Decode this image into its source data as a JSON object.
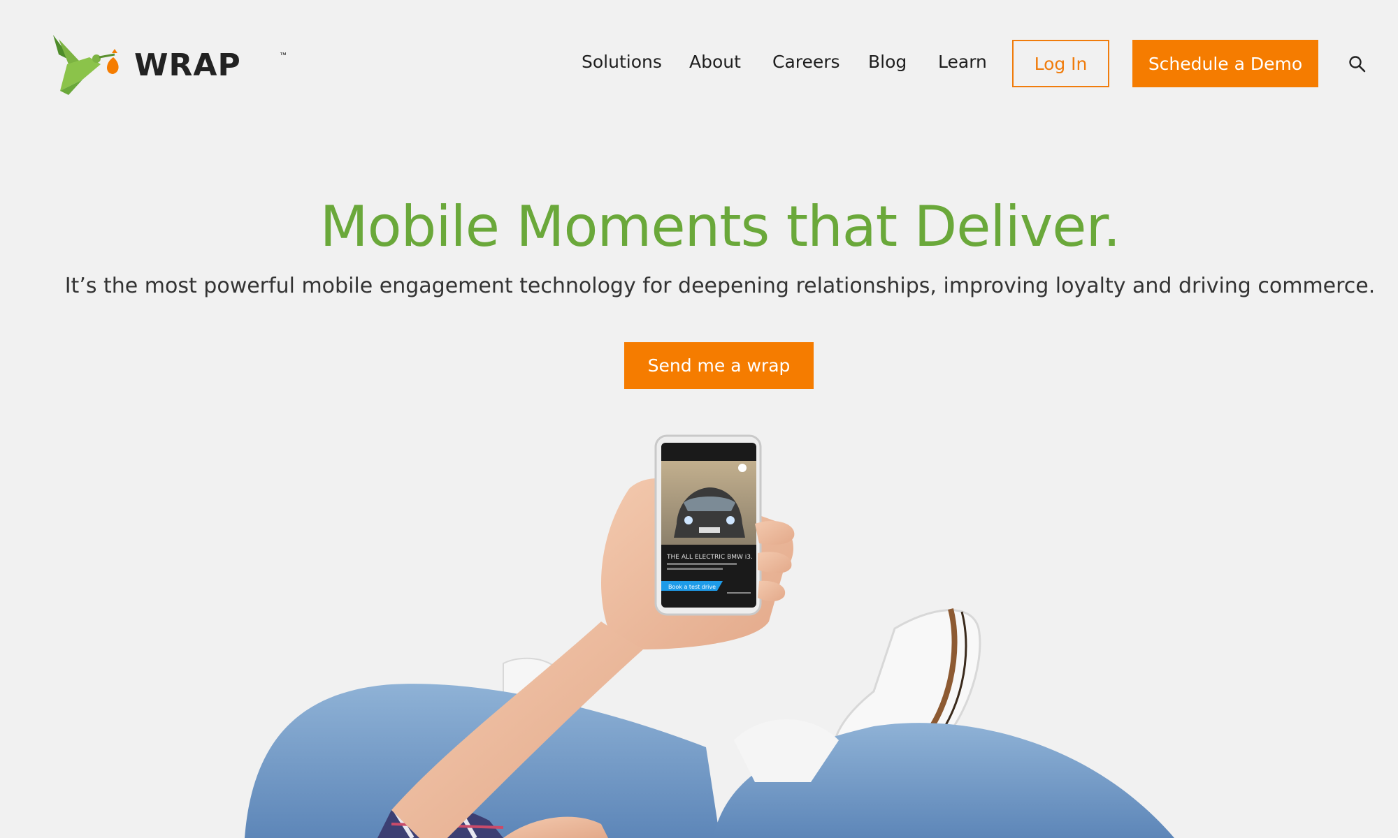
{
  "brand": {
    "name": "WRAP",
    "trademark": "™",
    "colors": {
      "green": "#6aa83a",
      "orange": "#f57c00",
      "background": "#f1f1f1"
    }
  },
  "nav": {
    "items": [
      {
        "label": "Solutions"
      },
      {
        "label": "About"
      },
      {
        "label": "Careers"
      },
      {
        "label": "Blog"
      },
      {
        "label": "Learn"
      }
    ],
    "login_label": "Log In",
    "demo_label": "Schedule a Demo",
    "search_icon": "search-icon"
  },
  "hero": {
    "title": "Mobile Moments that Deliver.",
    "subtitle": "It’s the most powerful mobile engagement technology for deepening relationships, improving loyalty and driving commerce.",
    "cta_label": "Send me a wrap"
  },
  "phone_ad": {
    "headline": "THE ALL ELECTRIC BMW i3.",
    "button_label": "Book a test drive"
  }
}
